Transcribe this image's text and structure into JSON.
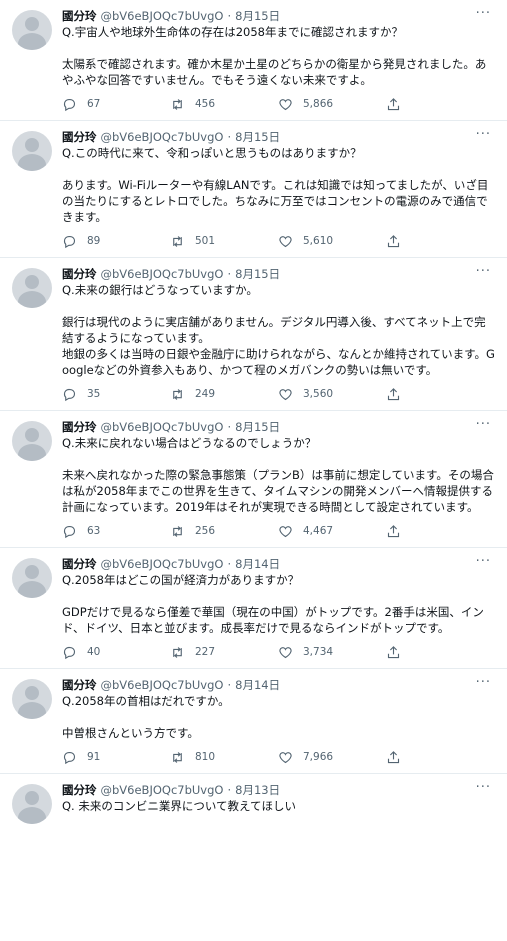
{
  "tweets": [
    {
      "name": "國分玲",
      "handle": "@bV6eBJOQc7bUvgO",
      "date": "8月15日",
      "question": "Q.宇宙人や地球外生命体の存在は2058年までに確認されますか？",
      "answer_lines": [
        "太陽系で確認されます。確か木星か土星のどちらかの衛星から発見されました。あやふやな回答ですいません。でもそう遠くない未来ですよ。"
      ],
      "replies": "67",
      "retweets": "456",
      "likes": "5,866"
    },
    {
      "name": "國分玲",
      "handle": "@bV6eBJOQc7bUvgO",
      "date": "8月15日",
      "question": "Q.この時代に来て、令和っぽいと思うものはありますか？",
      "answer_lines": [
        "あります。Wi-Fiルーターや有線LANです。これは知識では知ってましたが、いざ目の当たりにするとレトロでした。ちなみに万至ではコンセントの電源のみで通信できます。"
      ],
      "replies": "89",
      "retweets": "501",
      "likes": "5,610"
    },
    {
      "name": "國分玲",
      "handle": "@bV6eBJOQc7bUvgO",
      "date": "8月15日",
      "question": "Q.未来の銀行はどうなっていますか。",
      "answer_lines": [
        "銀行は現代のように実店舗がありません。デジタル円導入後、すべてネット上で完結するようになっています。",
        "地銀の多くは当時の日銀や金融庁に助けられながら、なんとか維持されています。Googleなどの外資参入もあり、かつて程のメガバンクの勢いは無いです。"
      ],
      "replies": "35",
      "retweets": "249",
      "likes": "3,560"
    },
    {
      "name": "國分玲",
      "handle": "@bV6eBJOQc7bUvgO",
      "date": "8月15日",
      "question": "Q.未来に戻れない場合はどうなるのでしょうか？",
      "answer_lines": [
        "未来へ戻れなかった際の緊急事態策（プランB）は事前に想定しています。その場合は私が2058年までこの世界を生きて、タイムマシンの開発メンバーへ情報提供する計画になっています。2019年はそれが実現できる時間として設定されています。"
      ],
      "replies": "63",
      "retweets": "256",
      "likes": "4,467"
    },
    {
      "name": "國分玲",
      "handle": "@bV6eBJOQc7bUvgO",
      "date": "8月14日",
      "question": "Q.2058年はどこの国が経済力がありますか？",
      "answer_lines": [
        "GDPだけで見るなら僅差で華国（現在の中国）がトップです。2番手は米国、インド、ドイツ、日本と並びます。成長率だけで見るならインドがトップです。"
      ],
      "replies": "40",
      "retweets": "227",
      "likes": "3,734"
    },
    {
      "name": "國分玲",
      "handle": "@bV6eBJOQc7bUvgO",
      "date": "8月14日",
      "question": "Q.2058年の首相はだれですか。",
      "answer_lines": [
        "中曽根さんという方です。"
      ],
      "replies": "91",
      "retweets": "810",
      "likes": "7,966"
    },
    {
      "name": "國分玲",
      "handle": "@bV6eBJOQc7bUvgO",
      "date": "8月13日",
      "question": "Q. 未来のコンビニ業界について教えてほしい",
      "answer_lines": [],
      "replies": "",
      "retweets": "",
      "likes": ""
    }
  ],
  "separator": "·",
  "more_icon": "more-horizontal-icon",
  "icons": {
    "reply": "reply-icon",
    "retweet": "retweet-icon",
    "like": "heart-icon",
    "share": "share-icon"
  },
  "colors": {
    "text": "#0f1419",
    "secondary": "#536471",
    "border": "#e6ecf0",
    "avatar": "#d4d9de"
  }
}
